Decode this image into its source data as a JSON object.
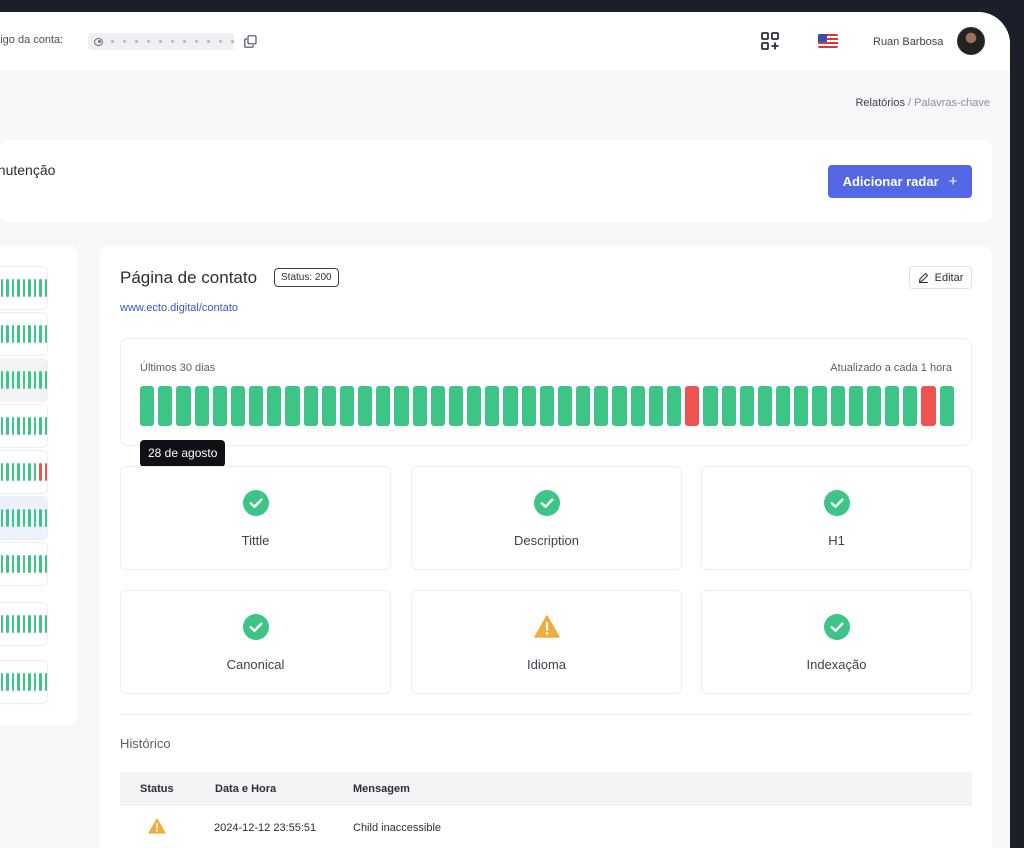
{
  "topbar": {
    "account_label": "ódigo da conta:",
    "user_name": "Ruan Barbosa",
    "icons": [
      "eye-icon",
      "copy-icon",
      "apps-add-icon",
      "us-flag-icon",
      "avatar"
    ]
  },
  "breadcrumb": {
    "parent": "Relatórios",
    "separator": "/",
    "current": "Palavras-chave"
  },
  "header": {
    "title": "anutenção",
    "add_button": "Adicionar radar",
    "add_icon": "+"
  },
  "monitor": {
    "title": "Página de contato",
    "status_chip": "Status: 200",
    "edit_label": "Editar",
    "url": "www.ecto.digital/contato",
    "uptime": {
      "left_label": "Últimos 30 dias",
      "right_label": "Atualizado a cada 1 hora",
      "days": [
        "ok",
        "ok",
        "ok",
        "ok",
        "ok",
        "ok",
        "ok",
        "ok",
        "ok",
        "ok",
        "ok",
        "ok",
        "ok",
        "ok",
        "ok",
        "ok",
        "ok",
        "ok",
        "ok",
        "ok",
        "ok",
        "ok",
        "ok",
        "ok",
        "ok",
        "ok",
        "ok",
        "ok",
        "ok",
        "ok",
        "down",
        "ok",
        "ok",
        "ok",
        "ok",
        "ok",
        "ok",
        "ok",
        "ok",
        "ok",
        "ok",
        "ok",
        "ok",
        "down",
        "ok"
      ],
      "tooltip": "28 de agosto"
    },
    "checks": [
      {
        "label": "Tittle",
        "state": "ok"
      },
      {
        "label": "Description",
        "state": "ok"
      },
      {
        "label": "H1",
        "state": "ok"
      },
      {
        "label": "Canonical",
        "state": "ok"
      },
      {
        "label": "Idioma",
        "state": "warning"
      },
      {
        "label": "Indexação",
        "state": "ok"
      }
    ]
  },
  "history": {
    "title": "Histórico",
    "columns": [
      "Status",
      "Data e Hora",
      "Mensagem"
    ],
    "rows": [
      {
        "status": "warning",
        "datetime": "2024-12-12 23:55:51",
        "message": "Child inaccessible"
      }
    ]
  },
  "colors": {
    "accent": "#5468e6",
    "ok": "#3cc587",
    "down": "#ef5350",
    "warning": "#f0ad3e",
    "link": "#3a54d6"
  }
}
